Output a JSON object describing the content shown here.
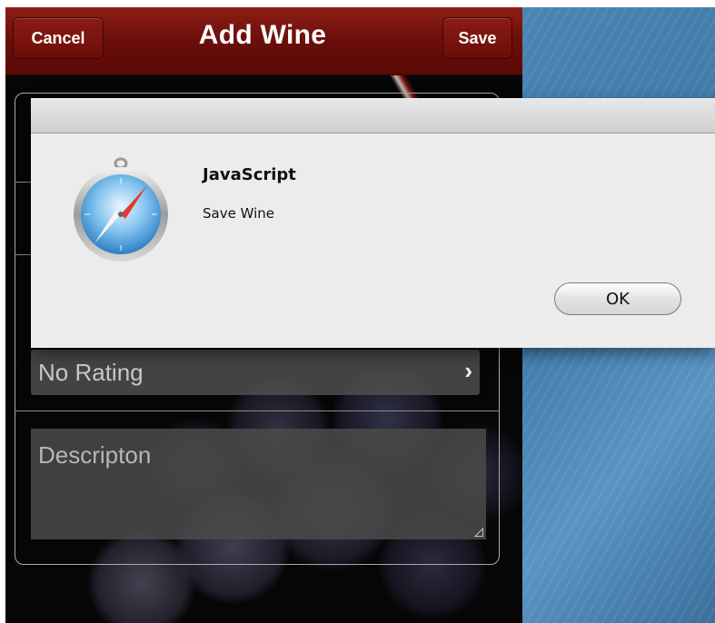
{
  "navbar": {
    "cancel_label": "Cancel",
    "title": "Add Wine",
    "save_label": "Save"
  },
  "form": {
    "rating_value": "No Rating",
    "rating_chevron": "›",
    "description_placeholder": "Descripton"
  },
  "dialog": {
    "icon": "safari-compass-icon",
    "title": "JavaScript",
    "message": "Save Wine",
    "ok_label": "OK"
  },
  "colors": {
    "navbar": "#6a0f0b",
    "desktop": "#4a86b3",
    "dialog": "#ececec"
  }
}
